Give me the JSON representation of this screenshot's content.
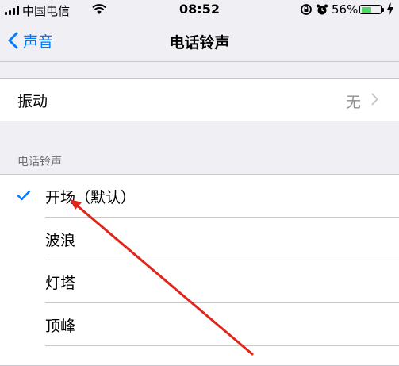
{
  "status_bar": {
    "carrier": "中国电信",
    "time": "08:52",
    "battery_percent": "56%",
    "battery_level": 0.56,
    "icons": [
      "signal-icon",
      "wifi-icon",
      "rotation-lock-icon",
      "alarm-icon",
      "battery-icon",
      "charging-bolt-icon"
    ]
  },
  "nav": {
    "back_label": "声音",
    "title": "电话铃声"
  },
  "vibration": {
    "label": "振动",
    "value": "无"
  },
  "ringtones": {
    "header": "电话铃声",
    "items": [
      {
        "label": "开场（默认）",
        "selected": true
      },
      {
        "label": "波浪",
        "selected": false
      },
      {
        "label": "灯塔",
        "selected": false
      },
      {
        "label": "顶峰",
        "selected": false
      }
    ]
  },
  "colors": {
    "accent": "#007aff",
    "annotation_arrow": "#e0251b",
    "battery_fill": "#4cd964"
  }
}
